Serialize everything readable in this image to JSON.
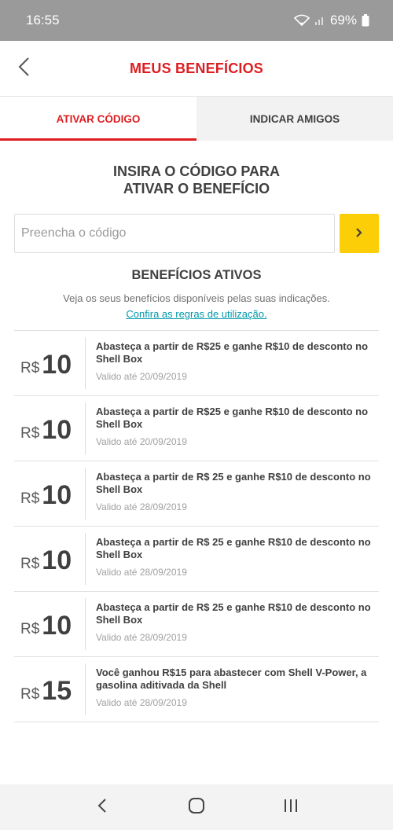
{
  "status_bar": {
    "time": "16:55",
    "battery": "69%"
  },
  "header": {
    "title": "MEUS BENEFÍCIOS"
  },
  "tabs": [
    {
      "label": "ATIVAR CÓDIGO",
      "active": true
    },
    {
      "label": "INDICAR AMIGOS",
      "active": false
    }
  ],
  "code": {
    "heading_line1": "INSIRA O CÓDIGO PARA",
    "heading_line2": "ATIVAR O BENEFÍCIO",
    "placeholder": "Preencha o código",
    "value": ""
  },
  "benefits": {
    "title": "BENEFÍCIOS ATIVOS",
    "subtitle": "Veja os seus benefícios disponíveis pelas suas indicações.",
    "rules_link": "Confira as regras de utilização.",
    "items": [
      {
        "currency": "R$",
        "value": "10",
        "description": "Abasteça a partir de R$25 e ganhe R$10 de desconto no Shell Box",
        "valid": "Valido até 20/09/2019"
      },
      {
        "currency": "R$",
        "value": "10",
        "description": "Abasteça a partir de R$25 e ganhe R$10 de desconto no Shell Box",
        "valid": "Valido até 20/09/2019"
      },
      {
        "currency": "R$",
        "value": "10",
        "description": "Abasteça a partir de R$ 25 e ganhe R$10 de desconto no Shell Box",
        "valid": "Valido até 28/09/2019"
      },
      {
        "currency": "R$",
        "value": "10",
        "description": "Abasteça a partir de R$ 25 e ganhe R$10 de desconto no Shell Box",
        "valid": "Valido até 28/09/2019"
      },
      {
        "currency": "R$",
        "value": "10",
        "description": "Abasteça a partir de R$ 25 e ganhe R$10 de desconto no Shell Box",
        "valid": "Valido até 28/09/2019"
      },
      {
        "currency": "R$",
        "value": "15",
        "description": "Você ganhou R$15 para abastecer com Shell V-Power, a gasolina aditivada da Shell",
        "valid": "Valido até 28/09/2019"
      }
    ]
  },
  "icons": {
    "back": "chevron-left-icon",
    "submit": "chevron-right-icon",
    "nav_back": "nav-back-icon",
    "nav_home": "nav-home-icon",
    "nav_recents": "nav-recents-icon"
  },
  "colors": {
    "brand_red": "#dd1d21",
    "brand_yellow": "#fbce07",
    "link": "#0097a9"
  }
}
